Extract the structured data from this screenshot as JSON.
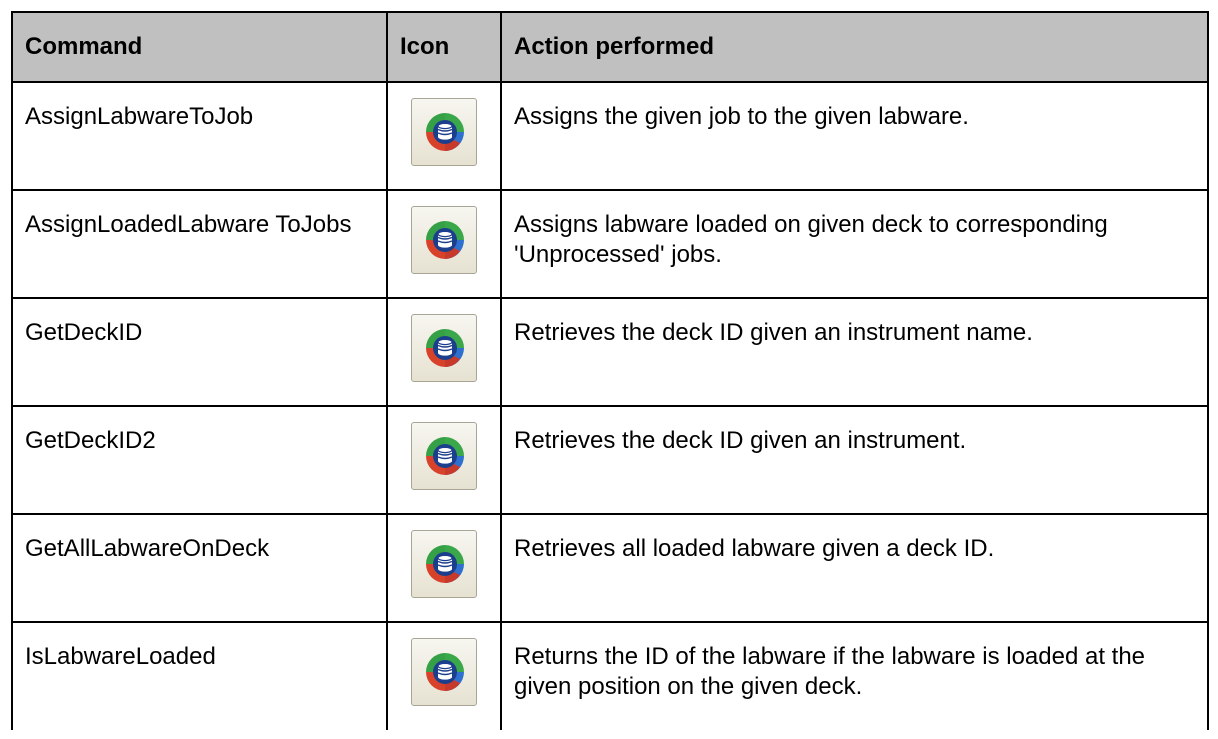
{
  "table": {
    "headers": [
      "Command",
      "Icon",
      "Action performed"
    ],
    "rows": [
      {
        "command": "AssignLabwareToJob",
        "icon": "database-sync-icon",
        "action": "Assigns the given job to the given labware."
      },
      {
        "command": "AssignLoadedLabware ToJobs",
        "icon": "database-sync-icon",
        "action": "Assigns labware loaded on given deck to corresponding 'Unprocessed' jobs."
      },
      {
        "command": "GetDeckID",
        "icon": "database-sync-icon",
        "action": "Retrieves the deck ID given an instrument name."
      },
      {
        "command": "GetDeckID2",
        "icon": "database-sync-icon",
        "action": "Retrieves the deck ID given an instrument."
      },
      {
        "command": "GetAllLabwareOnDeck",
        "icon": "database-sync-icon",
        "action": "Retrieves all loaded labware given a deck ID."
      },
      {
        "command": "IsLabwareLoaded",
        "icon": "database-sync-icon",
        "action": "Returns the ID of the labware if the labware is loaded at the given position on the given deck."
      }
    ]
  },
  "colors": {
    "header_bg": "#c0c0c0",
    "icon_green": "#3aa84a",
    "icon_blue": "#2f6fd0",
    "icon_red": "#d8412a"
  }
}
